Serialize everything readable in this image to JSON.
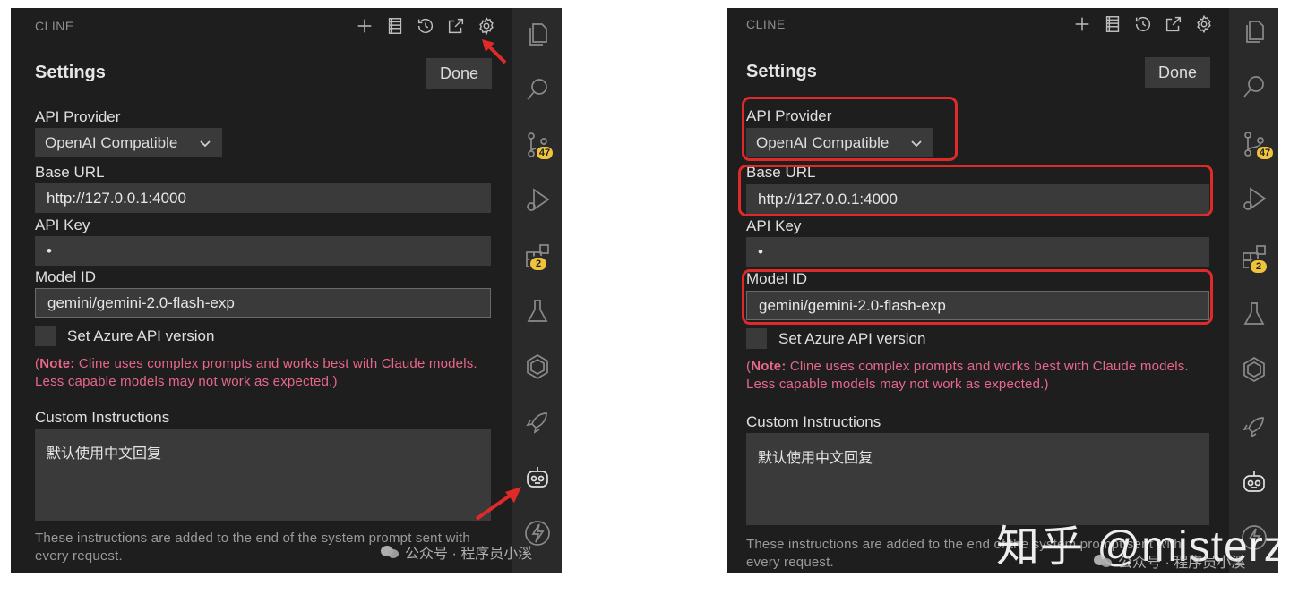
{
  "app": {
    "brand": "CLINE"
  },
  "settings": {
    "title": "Settings",
    "done_label": "Done",
    "api_provider_label": "API Provider",
    "api_provider_value": "OpenAI Compatible",
    "base_url_label": "Base URL",
    "base_url_value": "http://127.0.0.1:4000",
    "api_key_label": "API Key",
    "api_key_value": "•",
    "model_id_label": "Model ID",
    "model_id_value": "gemini/gemini-2.0-flash-exp",
    "azure_label": "Set Azure API version",
    "note_prefix": "(",
    "note_bold": "Note:",
    "note_text": " Cline uses complex prompts and works best with Claude models. Less capable models may not work as expected.)",
    "custom_instructions_label": "Custom Instructions",
    "custom_instructions_value": "默认使用中文回复",
    "helper_text": "These instructions are added to the end of the system prompt sent with every request."
  },
  "toolbar_icons": [
    "plus-icon",
    "database-icon",
    "history-icon",
    "open-external-icon",
    "gear-icon"
  ],
  "activity_bar": {
    "icons": [
      "files-icon",
      "search-icon",
      "source-control-icon",
      "run-debug-icon",
      "extensions-icon",
      "testing-icon",
      "hexagon-icon",
      "rocket-icon",
      "robot-icon",
      "lightning-icon"
    ],
    "source_control_badge": "47",
    "extensions_badge": "2"
  },
  "watermarks": {
    "wechat": "公众号 · 程序员小溪",
    "zhihu": "知乎 @misterz"
  },
  "colors": {
    "panel_bg": "#1e1e1e",
    "input_bg": "#3a3a3a",
    "note_pink": "#e8678b",
    "highlight_red": "#e02a2a",
    "badge_yellow": "#f0c33c"
  }
}
